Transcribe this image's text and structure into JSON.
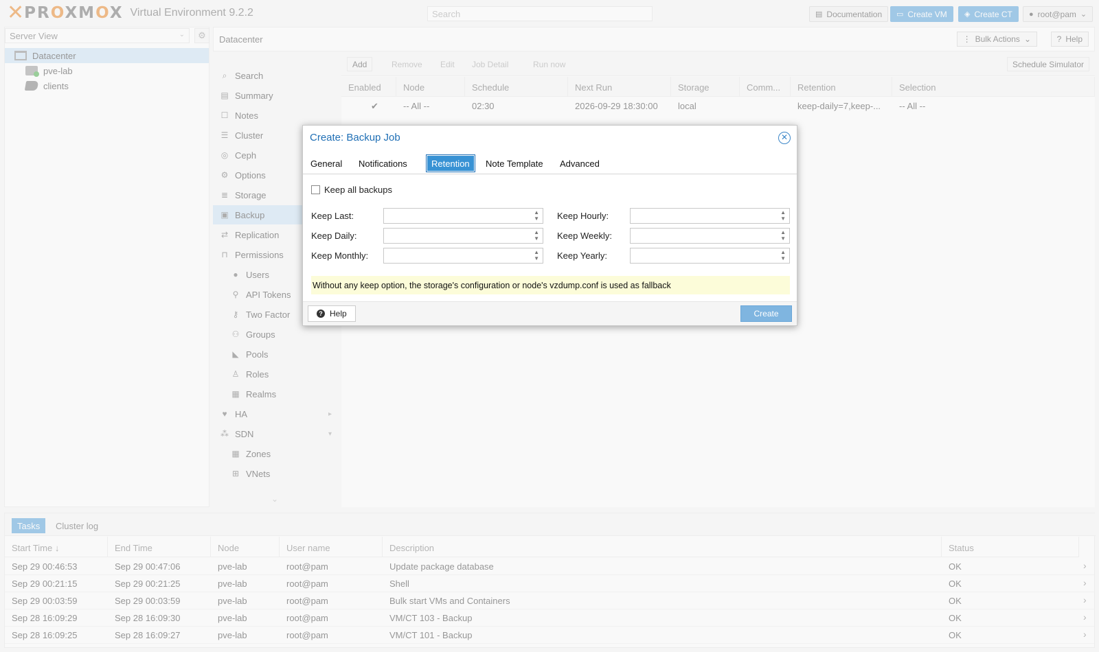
{
  "topbar": {
    "logo_word_pre": "PR",
    "logo_word_o1": "O",
    "logo_word_mid": "XM",
    "logo_word_o2": "O",
    "logo_word_end": "X",
    "product": "Virtual Environment 9.2.2",
    "search_placeholder": "Search",
    "documentation": "Documentation",
    "create_vm": "Create VM",
    "create_ct": "Create CT",
    "user": "root@pam"
  },
  "tree": {
    "view": "Server View",
    "items": [
      {
        "label": "Datacenter",
        "icon": "datacenter-icon"
      },
      {
        "label": "pve-lab",
        "icon": "node-icon"
      },
      {
        "label": "clients",
        "icon": "tag-icon"
      }
    ]
  },
  "content_header": {
    "title": "Datacenter",
    "bulk_actions": "Bulk Actions",
    "help": "Help"
  },
  "subnav": {
    "items": [
      {
        "label": "Search",
        "icon": "search-icon"
      },
      {
        "label": "Summary",
        "icon": "book-icon"
      },
      {
        "label": "Notes",
        "icon": "notes-icon"
      },
      {
        "label": "Cluster",
        "icon": "server-icon"
      },
      {
        "label": "Ceph",
        "icon": "ceph-icon"
      },
      {
        "label": "Options",
        "icon": "gear-icon"
      },
      {
        "label": "Storage",
        "icon": "database-icon"
      },
      {
        "label": "Backup",
        "icon": "floppy-icon"
      },
      {
        "label": "Replication",
        "icon": "retweet-icon"
      },
      {
        "label": "Permissions",
        "icon": "unlock-icon"
      },
      {
        "label": "Users",
        "icon": "user-icon"
      },
      {
        "label": "API Tokens",
        "icon": "key-icon"
      },
      {
        "label": "Two Factor",
        "icon": "two-factor-key-icon"
      },
      {
        "label": "Groups",
        "icon": "users-icon"
      },
      {
        "label": "Pools",
        "icon": "tags-icon"
      },
      {
        "label": "Roles",
        "icon": "male-icon"
      },
      {
        "label": "Realms",
        "icon": "address-book-icon"
      },
      {
        "label": "HA",
        "icon": "heartbeat-icon"
      },
      {
        "label": "SDN",
        "icon": "sdn-icon"
      },
      {
        "label": "Zones",
        "icon": "th-icon"
      },
      {
        "label": "VNets",
        "icon": "sitemap-icon"
      }
    ]
  },
  "backup_toolbar": {
    "add": "Add",
    "remove": "Remove",
    "edit": "Edit",
    "job_detail": "Job Detail",
    "run_now": "Run now",
    "schedule_simulator": "Schedule Simulator"
  },
  "backup_grid": {
    "columns": [
      "Enabled",
      "Node",
      "Schedule",
      "Next Run",
      "Storage",
      "Comm...",
      "Retention",
      "Selection"
    ],
    "rows": [
      {
        "enabled": "✔",
        "node": "-- All --",
        "schedule": "02:30",
        "next_run": "2026-09-29 18:30:00",
        "storage": "local",
        "comment": "",
        "retention": "keep-daily=7,keep-...",
        "selection": "-- All --"
      }
    ]
  },
  "tasks": {
    "tabs": [
      "Tasks",
      "Cluster log"
    ],
    "columns": [
      "Start Time ↓",
      "End Time",
      "Node",
      "User name",
      "Description",
      "Status"
    ],
    "rows": [
      {
        "start": "Sep 29 00:46:53",
        "end": "Sep 29 00:47:06",
        "node": "pve-lab",
        "user": "root@pam",
        "desc": "Update package database",
        "status": "OK"
      },
      {
        "start": "Sep 29 00:21:15",
        "end": "Sep 29 00:21:25",
        "node": "pve-lab",
        "user": "root@pam",
        "desc": "Shell",
        "status": "OK"
      },
      {
        "start": "Sep 29 00:03:59",
        "end": "Sep 29 00:03:59",
        "node": "pve-lab",
        "user": "root@pam",
        "desc": "Bulk start VMs and Containers",
        "status": "OK"
      },
      {
        "start": "Sep 28 16:09:29",
        "end": "Sep 28 16:09:30",
        "node": "pve-lab",
        "user": "root@pam",
        "desc": "VM/CT 103 - Backup",
        "status": "OK"
      },
      {
        "start": "Sep 28 16:09:25",
        "end": "Sep 28 16:09:27",
        "node": "pve-lab",
        "user": "root@pam",
        "desc": "VM/CT 101 - Backup",
        "status": "OK"
      }
    ]
  },
  "modal": {
    "title": "Create: Backup Job",
    "tabs": [
      "General",
      "Notifications",
      "Retention",
      "Note Template",
      "Advanced"
    ],
    "active_tab": "Retention",
    "keep_all": "Keep all backups",
    "fields": {
      "keep_last": "Keep Last:",
      "keep_hourly": "Keep Hourly:",
      "keep_daily": "Keep Daily:",
      "keep_weekly": "Keep Weekly:",
      "keep_monthly": "Keep Monthly:",
      "keep_yearly": "Keep Yearly:"
    },
    "note": "Without any keep option, the storage's configuration or node's vzdump.conf is used as fallback",
    "help": "Help",
    "create": "Create"
  }
}
